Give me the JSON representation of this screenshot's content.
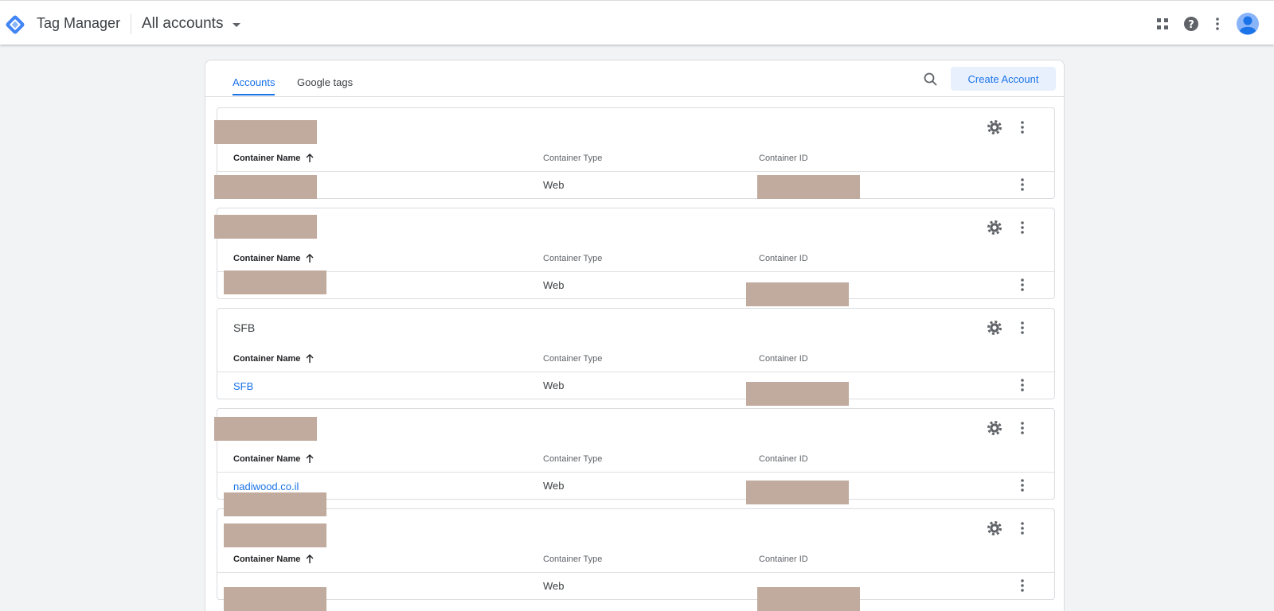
{
  "header": {
    "product_name": "Tag Manager",
    "account_selector": "All accounts",
    "icons": [
      "apps-icon",
      "help-icon",
      "more-vert-icon",
      "avatar-icon"
    ]
  },
  "tabs": [
    {
      "label": "Accounts",
      "active": true
    },
    {
      "label": "Google tags",
      "active": false
    }
  ],
  "create_button": "Create Account",
  "table_headers": {
    "name": "Container Name",
    "type": "Container Type",
    "id": "Container ID"
  },
  "accounts": [
    {
      "name": "",
      "name_redacted": true,
      "container": {
        "name": "",
        "name_redacted": true,
        "type": "Web",
        "id_redacted": true
      }
    },
    {
      "name": "",
      "name_redacted": true,
      "container": {
        "name": "",
        "name_redacted": true,
        "type": "Web",
        "id_redacted": true
      }
    },
    {
      "name": "SFB",
      "name_redacted": false,
      "container": {
        "name": "SFB",
        "name_redacted": false,
        "type": "Web",
        "id_redacted": true
      }
    },
    {
      "name": "",
      "name_redacted": true,
      "container": {
        "name": "nadiwood.co.il",
        "name_redacted": true,
        "type": "Web",
        "id_redacted": true
      }
    },
    {
      "name": "",
      "name_redacted": true,
      "container": {
        "name": "",
        "name_redacted": true,
        "type": "Web",
        "id_redacted": true
      }
    }
  ],
  "colors": {
    "accent": "#1a73e8",
    "button_bg": "#e8f0fe",
    "page_bg": "#f1f3f4",
    "redaction": "#c1ab9e"
  }
}
